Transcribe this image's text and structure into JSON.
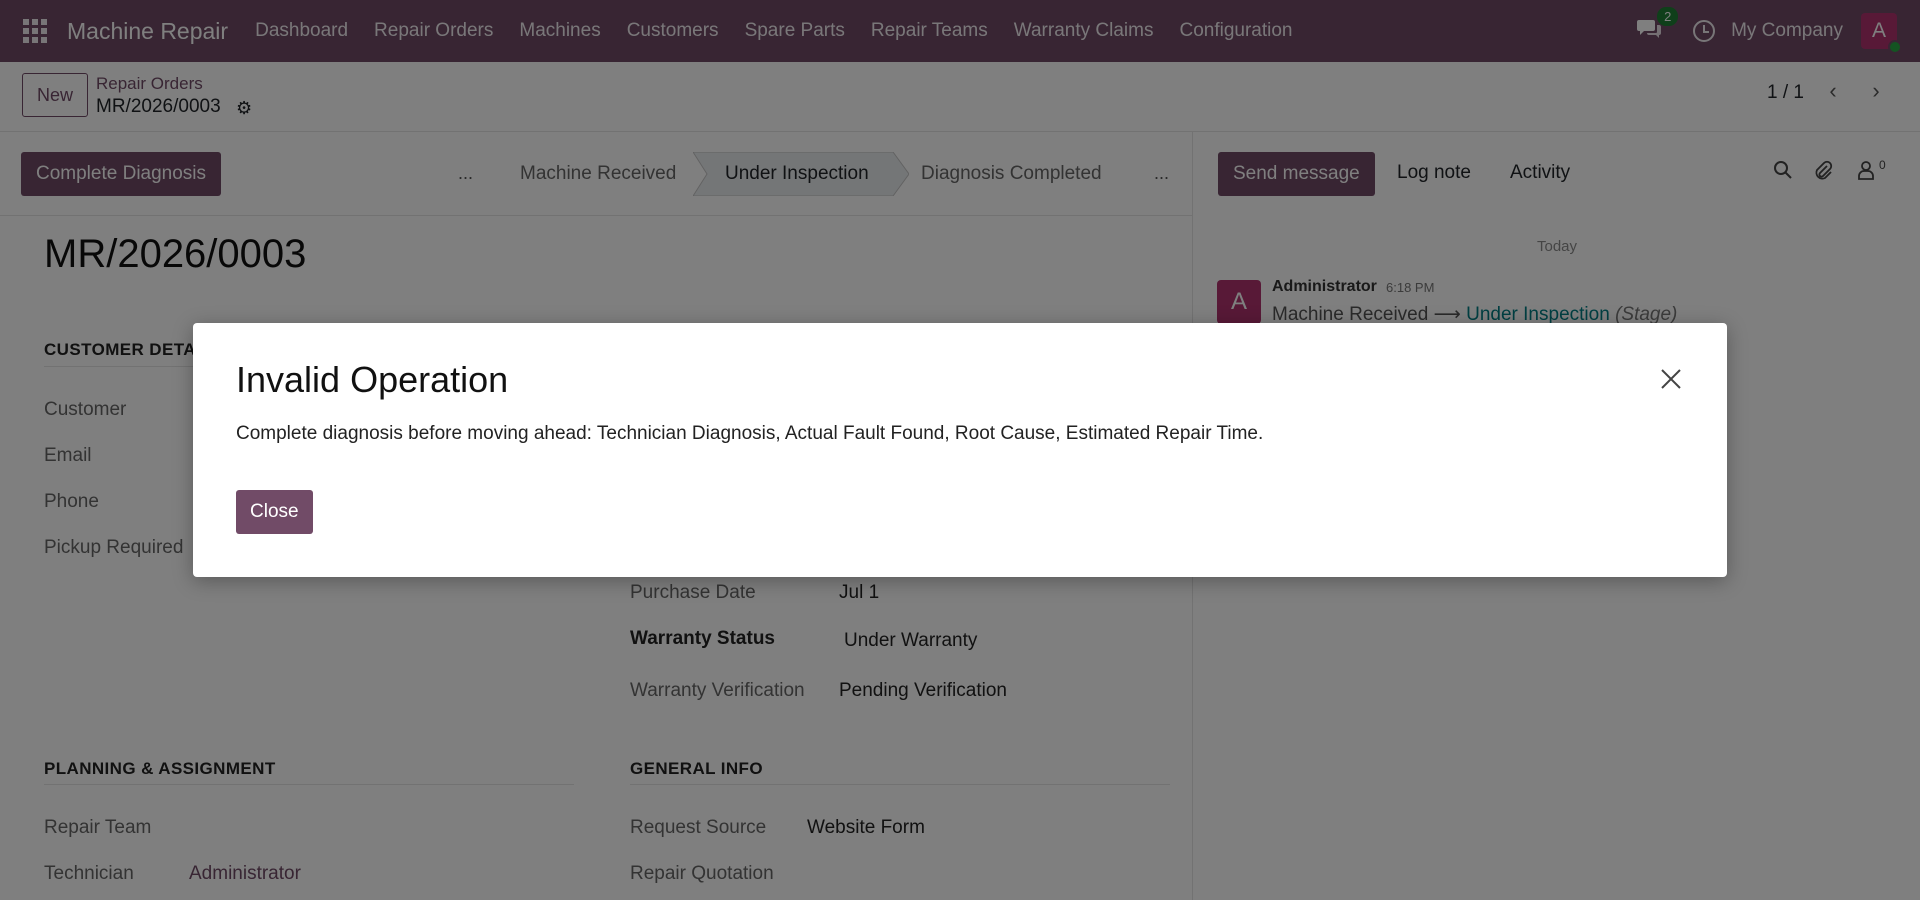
{
  "navbar": {
    "app_name": "Machine Repair",
    "menu": [
      "Dashboard",
      "Repair Orders",
      "Machines",
      "Customers",
      "Spare Parts",
      "Repair Teams",
      "Warranty Claims",
      "Configuration"
    ],
    "chat_badge": "2",
    "company": "My Company",
    "avatar_initial": "A"
  },
  "control_panel": {
    "new_label": "New",
    "breadcrumb_parent": "Repair Orders",
    "breadcrumb_current": "MR/2026/0003",
    "pager": "1 / 1"
  },
  "statusbar": {
    "action_button": "Complete Diagnosis",
    "dots": "...",
    "stages": [
      "Machine Received",
      "Under Inspection",
      "Diagnosis Completed"
    ],
    "current_stage": "Under Inspection"
  },
  "chatter": {
    "send_message": "Send message",
    "log_note": "Log note",
    "activity": "Activity",
    "followers_count": "0",
    "date_separator": "Today",
    "message": {
      "avatar_initial": "A",
      "author": "Administrator",
      "time": "6:18 PM",
      "from_value": "Machine Received",
      "arrow": "⟶",
      "to_value": "Under Inspection",
      "field": "(Stage)"
    }
  },
  "form": {
    "title": "MR/2026/0003",
    "sections": {
      "customer": "CUSTOMER DETAILS",
      "planning": "PLANNING & ASSIGNMENT",
      "general": "GENERAL INFO"
    },
    "customer_fields": [
      "Customer",
      "Email",
      "Phone",
      "Pickup Required"
    ],
    "machine": {
      "purchase_date_label": "Purchase Date",
      "purchase_date": "Jul 1",
      "warranty_status_label": "Warranty Status",
      "warranty_status": "Under Warranty",
      "warranty_verification_label": "Warranty Verification",
      "warranty_verification": "Pending Verification"
    },
    "planning": {
      "repair_team_label": "Repair Team",
      "technician_label": "Technician",
      "technician": "Administrator"
    },
    "general": {
      "request_source_label": "Request Source",
      "request_source": "Website Form",
      "repair_quotation_label": "Repair Quotation"
    }
  },
  "modal": {
    "title": "Invalid Operation",
    "body": "Complete diagnosis before moving ahead: Technician Diagnosis, Actual Fault Found, Root Cause, Estimated Repair Time.",
    "close_label": "Close"
  },
  "colors": {
    "brand": "#714b67",
    "avatar": "#b0326e",
    "link_teal": "#017e84",
    "online": "#28a745"
  }
}
